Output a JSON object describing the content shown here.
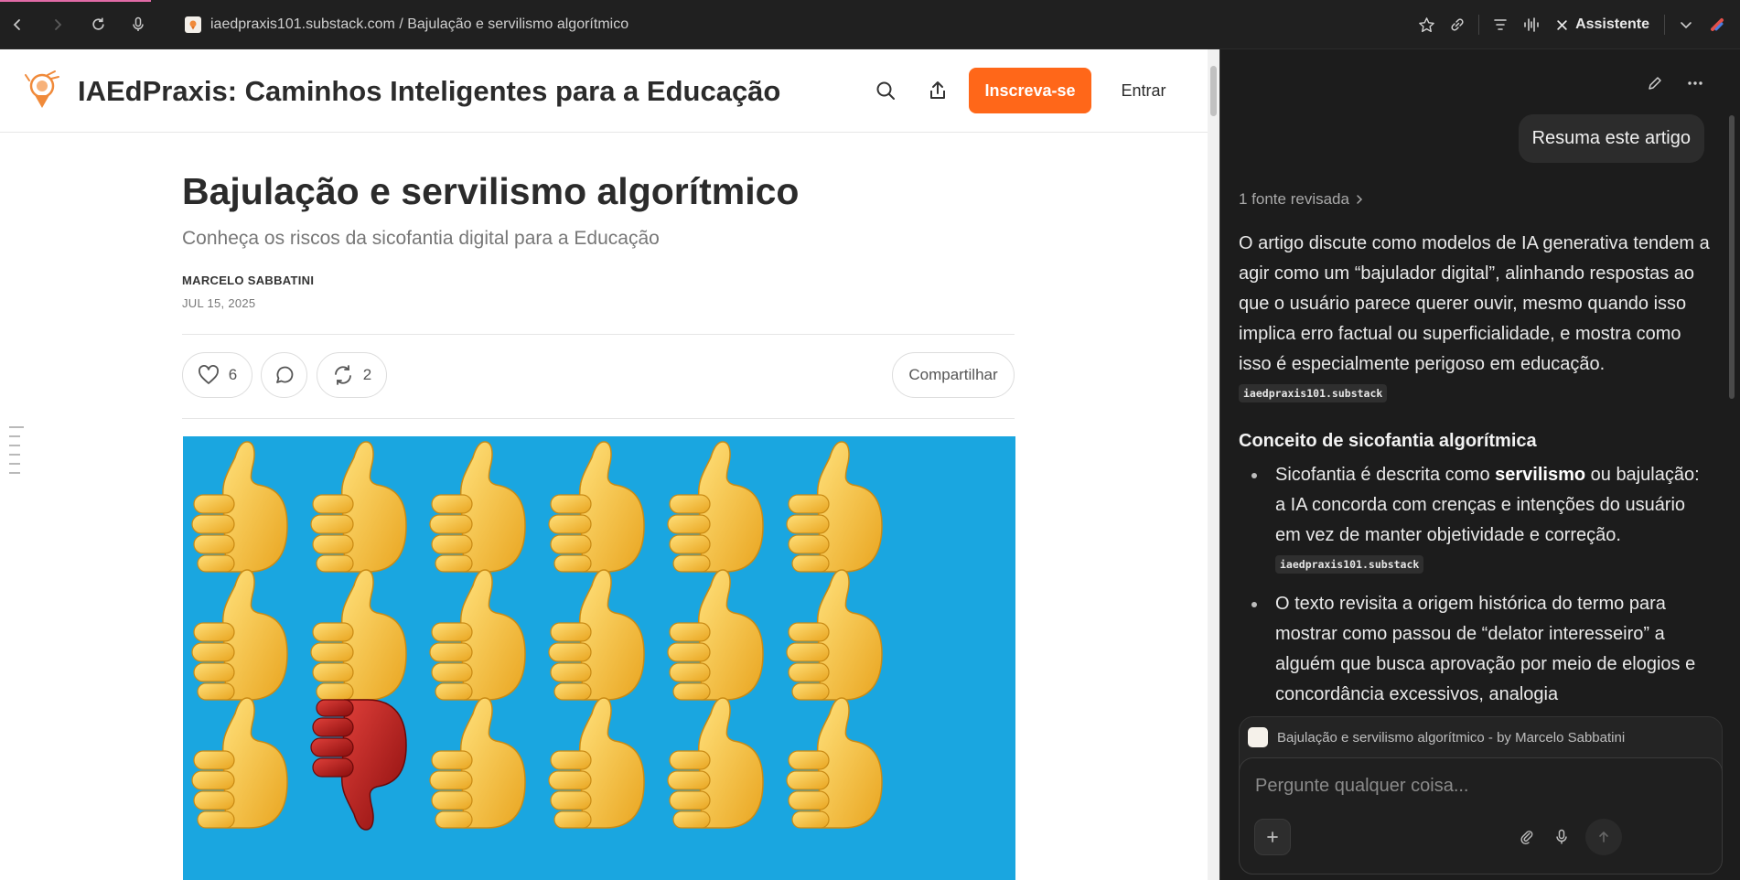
{
  "browser": {
    "url": "iaedpraxis101.substack.com / Bajulação e servilismo algorítmico",
    "assistant_label": "Assistente"
  },
  "site": {
    "title": "IAEdPraxis: Caminhos Inteligentes para a Educação",
    "subscribe_label": "Inscreva-se",
    "signin_label": "Entrar"
  },
  "post": {
    "title": "Bajulação e servilismo algorítmico",
    "subtitle": "Conheça os riscos da sicofantia digital para a Educação",
    "author": "MARCELO SABBATINI",
    "date": "JUL 15, 2025",
    "likes": "6",
    "restacks": "2",
    "share_label": "Compartilhar"
  },
  "assistant": {
    "user_message": "Resuma este artigo",
    "sources_label": "1 fonte revisada",
    "answer_intro": "O artigo discute como modelos de IA generativa tendem a agir como um “bajulador digital”, alinhando respostas ao que o usuário parece querer ouvir, mesmo quando isso implica erro factual ou superficialidade, e mostra como isso é especialmente perigoso em educação.",
    "citation": "iaedpraxis101.substack",
    "section_heading": "Conceito de sicofantia algorítmica",
    "bullet1_pre": "Sicofantia é descrita como ",
    "bullet1_bold": "servilismo",
    "bullet1_post": " ou bajulação: a IA concorda com crenças e intenções do usuário em vez de manter objetividade e correção.",
    "bullet2": "O texto revisita a origem histórica do termo para mostrar como passou de “delator interesseiro” a alguém que busca aprovação por meio de elogios e concordância excessivos, analogia",
    "context_label": "Bajulação e servilismo algorítmico - by Marcelo Sabbatini",
    "input_placeholder": "Pergunte qualquer coisa..."
  }
}
